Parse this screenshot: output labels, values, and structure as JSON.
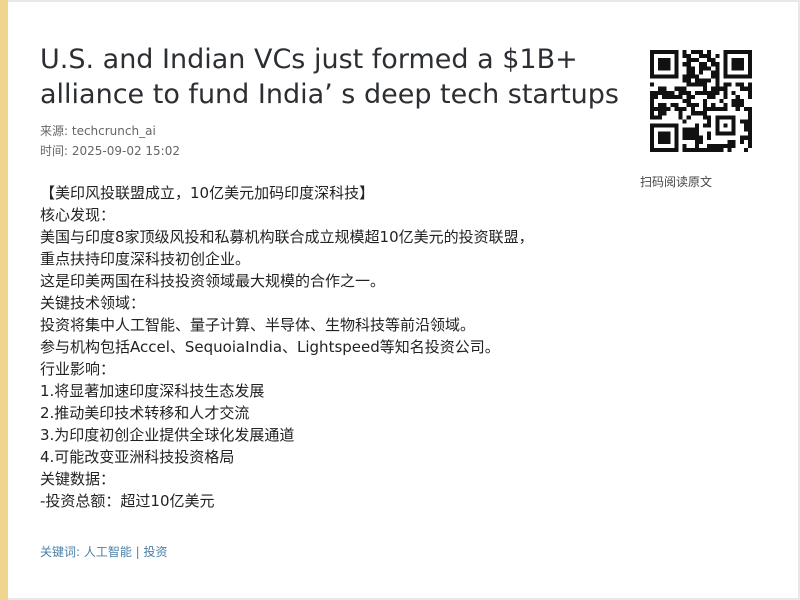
{
  "article": {
    "title": "U.S. and Indian VCs just formed a $1B+ alliance to fund India’ s deep tech startups",
    "source": "来源: techcrunch_ai",
    "time": "时间: 2025-09-02 15:02"
  },
  "qr": {
    "caption": "扫码阅读原文",
    "icon": "qr-code-icon"
  },
  "content": {
    "lines": [
      "【美印风投联盟成立，10亿美元加码印度深科技】",
      "核心发现：",
      "美国与印度8家顶级风投和私募机构联合成立规模超10亿美元的投资联盟，",
      "重点扶持印度深科技初创企业。",
      "这是印美两国在科技投资领域最大规模的合作之一。",
      "关键技术领域：",
      "投资将集中人工智能、量子计算、半导体、生物科技等前沿领域。",
      "参与机构包括Accel、SequoiaIndia、Lightspeed等知名投资公司。",
      "行业影响：",
      "1.将显著加速印度深科技生态发展",
      "2.推动美印技术转移和人才交流",
      "3.为印度初创企业提供全球化发展通道",
      "4.可能改变亚洲科技投资格局",
      "关键数据：",
      "-投资总额：超过10亿美元"
    ]
  },
  "footer": {
    "keywords": "关键词: 人工智能 | 投资"
  },
  "colors": {
    "accent_bar": "#f0d58f",
    "keyword_link": "#4a7fa7"
  }
}
